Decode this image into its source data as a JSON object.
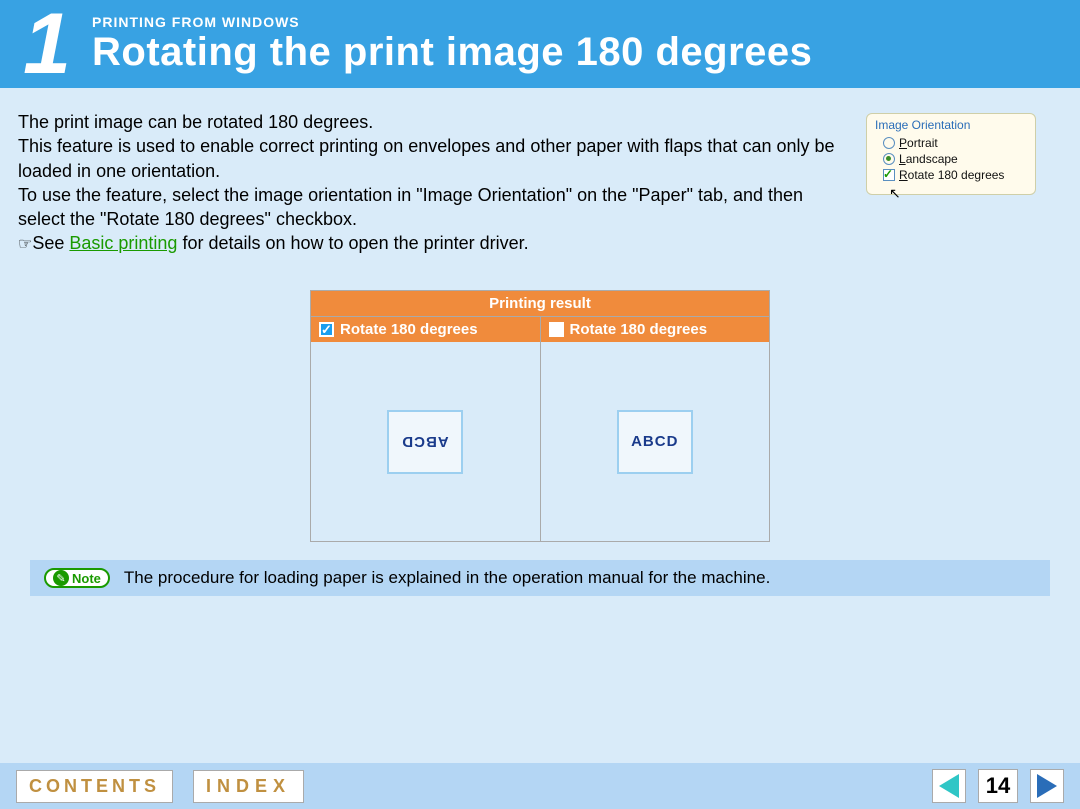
{
  "header": {
    "number": "1",
    "breadcrumb": "PRINTING FROM WINDOWS",
    "title": "Rotating the print image 180 degrees"
  },
  "body": {
    "p1": "The print image can be rotated 180 degrees.",
    "p2": "This feature is used to enable correct printing on envelopes and other paper with flaps that can only be loaded in one orientation.",
    "p3": "To use the feature, select the image orientation in \"Image Orientation\" on the \"Paper\" tab, and then select the \"Rotate 180 degrees\" checkbox.",
    "see_prefix": "See ",
    "see_link": "Basic printing",
    "see_suffix": " for details on how to open the printer driver."
  },
  "orientation_panel": {
    "title": "Image Orientation",
    "options": [
      {
        "label_pre": "P",
        "label_rest": "ortrait",
        "checked": false,
        "type": "radio"
      },
      {
        "label_pre": "L",
        "label_rest": "andscape",
        "checked": true,
        "type": "radio"
      },
      {
        "label_pre": "R",
        "label_rest": "otate 180 degrees",
        "checked": true,
        "type": "checkbox"
      }
    ]
  },
  "result_table": {
    "title": "Printing result",
    "col_a_label": "Rotate 180 degrees",
    "col_b_label": "Rotate 180 degrees",
    "sample_text": "ABCD"
  },
  "note": {
    "badge": "Note",
    "text": "The procedure for loading paper is explained in the operation manual for the machine."
  },
  "footer": {
    "contents": "CONTENTS",
    "index": "INDEX",
    "page": "14"
  }
}
